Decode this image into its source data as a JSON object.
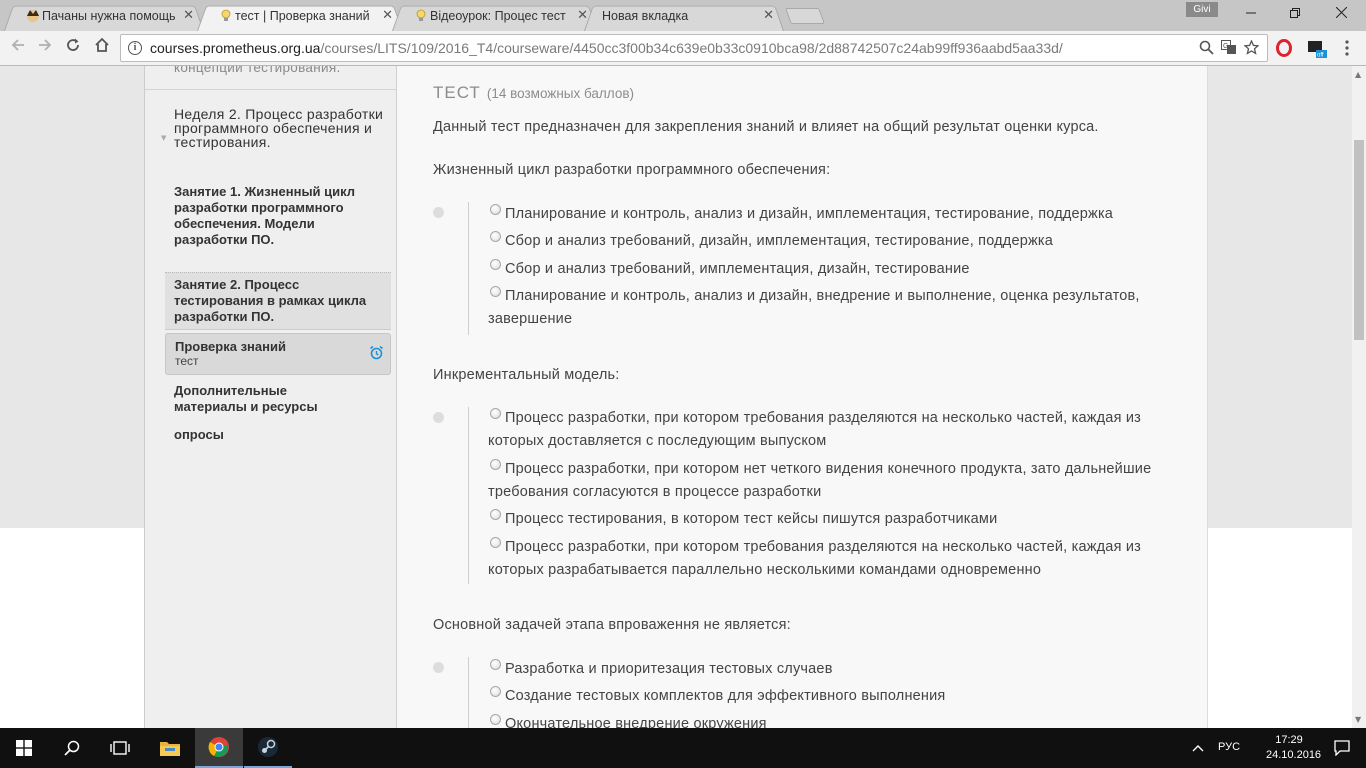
{
  "browser": {
    "tabs": [
      {
        "title": "Пачаны нужна помощь",
        "icon": "anime-avatar-icon",
        "active": false
      },
      {
        "title": "тест | Проверка знаний",
        "icon": "lightbulb-icon",
        "active": true
      },
      {
        "title": "Відеоурок: Процес тест",
        "icon": "lightbulb-icon",
        "active": false
      },
      {
        "title": "Новая вкладка",
        "icon": "",
        "active": false
      }
    ],
    "profile_name": "Givi",
    "url": {
      "host": "courses.prometheus.org.ua",
      "path": "/courses/LITS/109/2016_T4/courseware/4450cc3f00b34c639e0b33c0910bca98/2d88742507c24ab99ff936aabd5aa33d/"
    }
  },
  "sidebar": {
    "prev_section": "концепции тестирования.",
    "week": "Неделя 2. Процесс разработки программного обеспечения и тестирования.",
    "lessons": [
      {
        "label": "Занятие 1. Жизненный цикл разработки программного обеспечения. Модели разработки ПО."
      },
      {
        "label": "Занятие 2. Процесс тестирования в рамках цикла разработки ПО."
      }
    ],
    "unit": {
      "title": "Проверка знаний",
      "subtitle": "тест"
    },
    "extras": [
      {
        "label": "Дополнительные материалы и ресурсы"
      },
      {
        "label": "опросы"
      }
    ]
  },
  "content": {
    "title": "ТЕСТ",
    "points": "(14 возможных баллов)",
    "intro": "Данный тест предназначен для закрепления знаний и влияет на общий результат оценки курса.",
    "questions": [
      {
        "text": "Жизненный цикл разработки программного обеспечения:",
        "options": [
          "Планирование и контроль, анализ и дизайн, имплементация, тестирование, поддержка",
          "Сбор и анализ требований, дизайн, имплементация, тестирование, поддержка",
          "Сбор и анализ требований, имплементация, дизайн, тестирование",
          "Планирование и контроль, анализ и дизайн, внедрение и выполнение, оценка результатов, завершение"
        ]
      },
      {
        "text": "Инкрементальный модель:",
        "options": [
          "Процесс разработки, при котором требования разделяются на несколько частей, каждая из которых доставляется с последующим выпуском",
          "Процесс разработки, при котором нет четкого видения конечного продукта, зато дальнейшие требования согласуются в процессе разработки",
          "Процесс тестирования, в котором тест кейсы пишутся разработчиками",
          "Процесс разработки, при котором требования разделяются на несколько частей, каждая из которых разрабатывается параллельно несколькими командами одновременно"
        ]
      },
      {
        "text": "Основной задачей этапа впроваження не является:",
        "options": [
          "Разработка и приоритезация тестовых случаев",
          "Создание тестовых комплектов для эффективного выполнения",
          "Окончательное внедрение окружения"
        ]
      }
    ]
  },
  "taskbar": {
    "language": "РУС",
    "time": "17:29",
    "date": "24.10.2016"
  },
  "colors": {
    "accent_blue": "#1e90d8",
    "text": "#444444",
    "taskbar": "#101010"
  }
}
